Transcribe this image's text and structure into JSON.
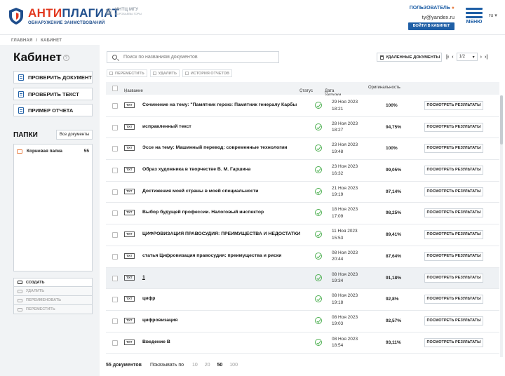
{
  "header": {
    "logo_main_a": "АНТИ",
    "logo_main_b": "ПЛАГИАТ",
    "logo_sub": "ОБНАРУЖЕНИЕ ЗАИМСТВОВАНИЙ",
    "partner_title": "ИНТЦ МГУ",
    "partner_sub": "ВОРОБЬЁВЫ ГОРЫ",
    "user_label": "ПОЛЬЗОВАТЕЛЬ",
    "user_email": "ty@yandex.ru",
    "login_button": "ВОЙТИ В КАБИНЕТ",
    "menu_label": "МЕНЮ",
    "lang": "ru"
  },
  "breadcrumb": [
    "ГЛАВНАЯ",
    "/",
    "КАБИНЕТ"
  ],
  "sidebar": {
    "title": "Кабинет",
    "buttons": [
      "ПРОВЕРИТЬ ДОКУМЕНТ",
      "ПРОВЕРИТЬ ТЕКСТ",
      "ПРИМЕР ОТЧЕТА"
    ],
    "folders_title": "ПАПКИ",
    "all_docs": "Все документы",
    "folder_name": "Корневая папка",
    "folder_count": "55",
    "actions": [
      "СОЗДАТЬ",
      "УДАЛИТЬ",
      "ПЕРЕИМЕНОВАТЬ",
      "ПЕРЕМЕСТИТЬ"
    ]
  },
  "main": {
    "search_placeholder": "Поиск по названиям документов",
    "deleted_docs": "УДАЛЕННЫЕ ДОКУМЕНТЫ",
    "page_current": "1/2",
    "toolbar": [
      "ПЕРЕМЕСТИТЬ",
      "УДАЛИТЬ",
      "ИСТОРИЯ ОТЧЕТОВ"
    ],
    "columns": {
      "name": "Название",
      "status": "Статус",
      "date": "Дата загрузки",
      "originality": "Оригинальность"
    },
    "view_label": "ПОСМОТРЕТЬ РЕЗУЛЬТАТЫ",
    "file_type": "TXT",
    "rows": [
      {
        "title": "Сочинение на тему: \"Памятник герою: Памятник генералу Карбы",
        "date": "29 Ноя 2023",
        "time": "18:21",
        "pct": "100%"
      },
      {
        "title": "исправленный текст",
        "date": "28 Ноя 2023",
        "time": "18:27",
        "pct": "94,75%"
      },
      {
        "title": "Эссе на тему: Машинный перевод: современные технологии",
        "date": "23 Ноя 2023",
        "time": "19:48",
        "pct": "100%"
      },
      {
        "title": "Образ художника в творчестве В. М. Гаршина",
        "date": "23 Ноя 2023",
        "time": "16:32",
        "pct": "99,05%"
      },
      {
        "title": "Достижения моей страны в моей специальности",
        "date": "21 Ноя 2023",
        "time": "19:19",
        "pct": "97,14%"
      },
      {
        "title": "Выбор будущей профессии. Налоговый инспектор",
        "date": "18 Ноя 2023",
        "time": "17:09",
        "pct": "98,25%"
      },
      {
        "title": "ЦИФРОВИЗАЦИЯ ПРАВОСУДИЯ: ПРЕИМУЩЕСТВА И НЕДОСТАТКИ",
        "date": "11 Ноя 2023",
        "time": "15:53",
        "pct": "89,41%"
      },
      {
        "title": "статья Цифровизация правосудия: преимущества и риски",
        "date": "08 Ноя 2023",
        "time": "20:44",
        "pct": "87,64%"
      },
      {
        "title": "1",
        "date": "08 Ноя 2023",
        "time": "19:34",
        "pct": "91,18%"
      },
      {
        "title": "цифр",
        "date": "08 Ноя 2023",
        "time": "19:18",
        "pct": "92,8%"
      },
      {
        "title": "цифровизация",
        "date": "08 Ноя 2023",
        "time": "19:03",
        "pct": "92,57%"
      },
      {
        "title": "Введение В",
        "date": "08 Ноя 2023",
        "time": "18:54",
        "pct": "93,11%"
      }
    ],
    "footer": {
      "count": "55 документов",
      "per_page_label": "Показывать по",
      "options": [
        "10",
        "20",
        "50",
        "100"
      ]
    }
  },
  "colors": {
    "brand_blue": "#1f5fa6",
    "brand_red": "#e2381e",
    "status_ok": "#4caf50"
  }
}
